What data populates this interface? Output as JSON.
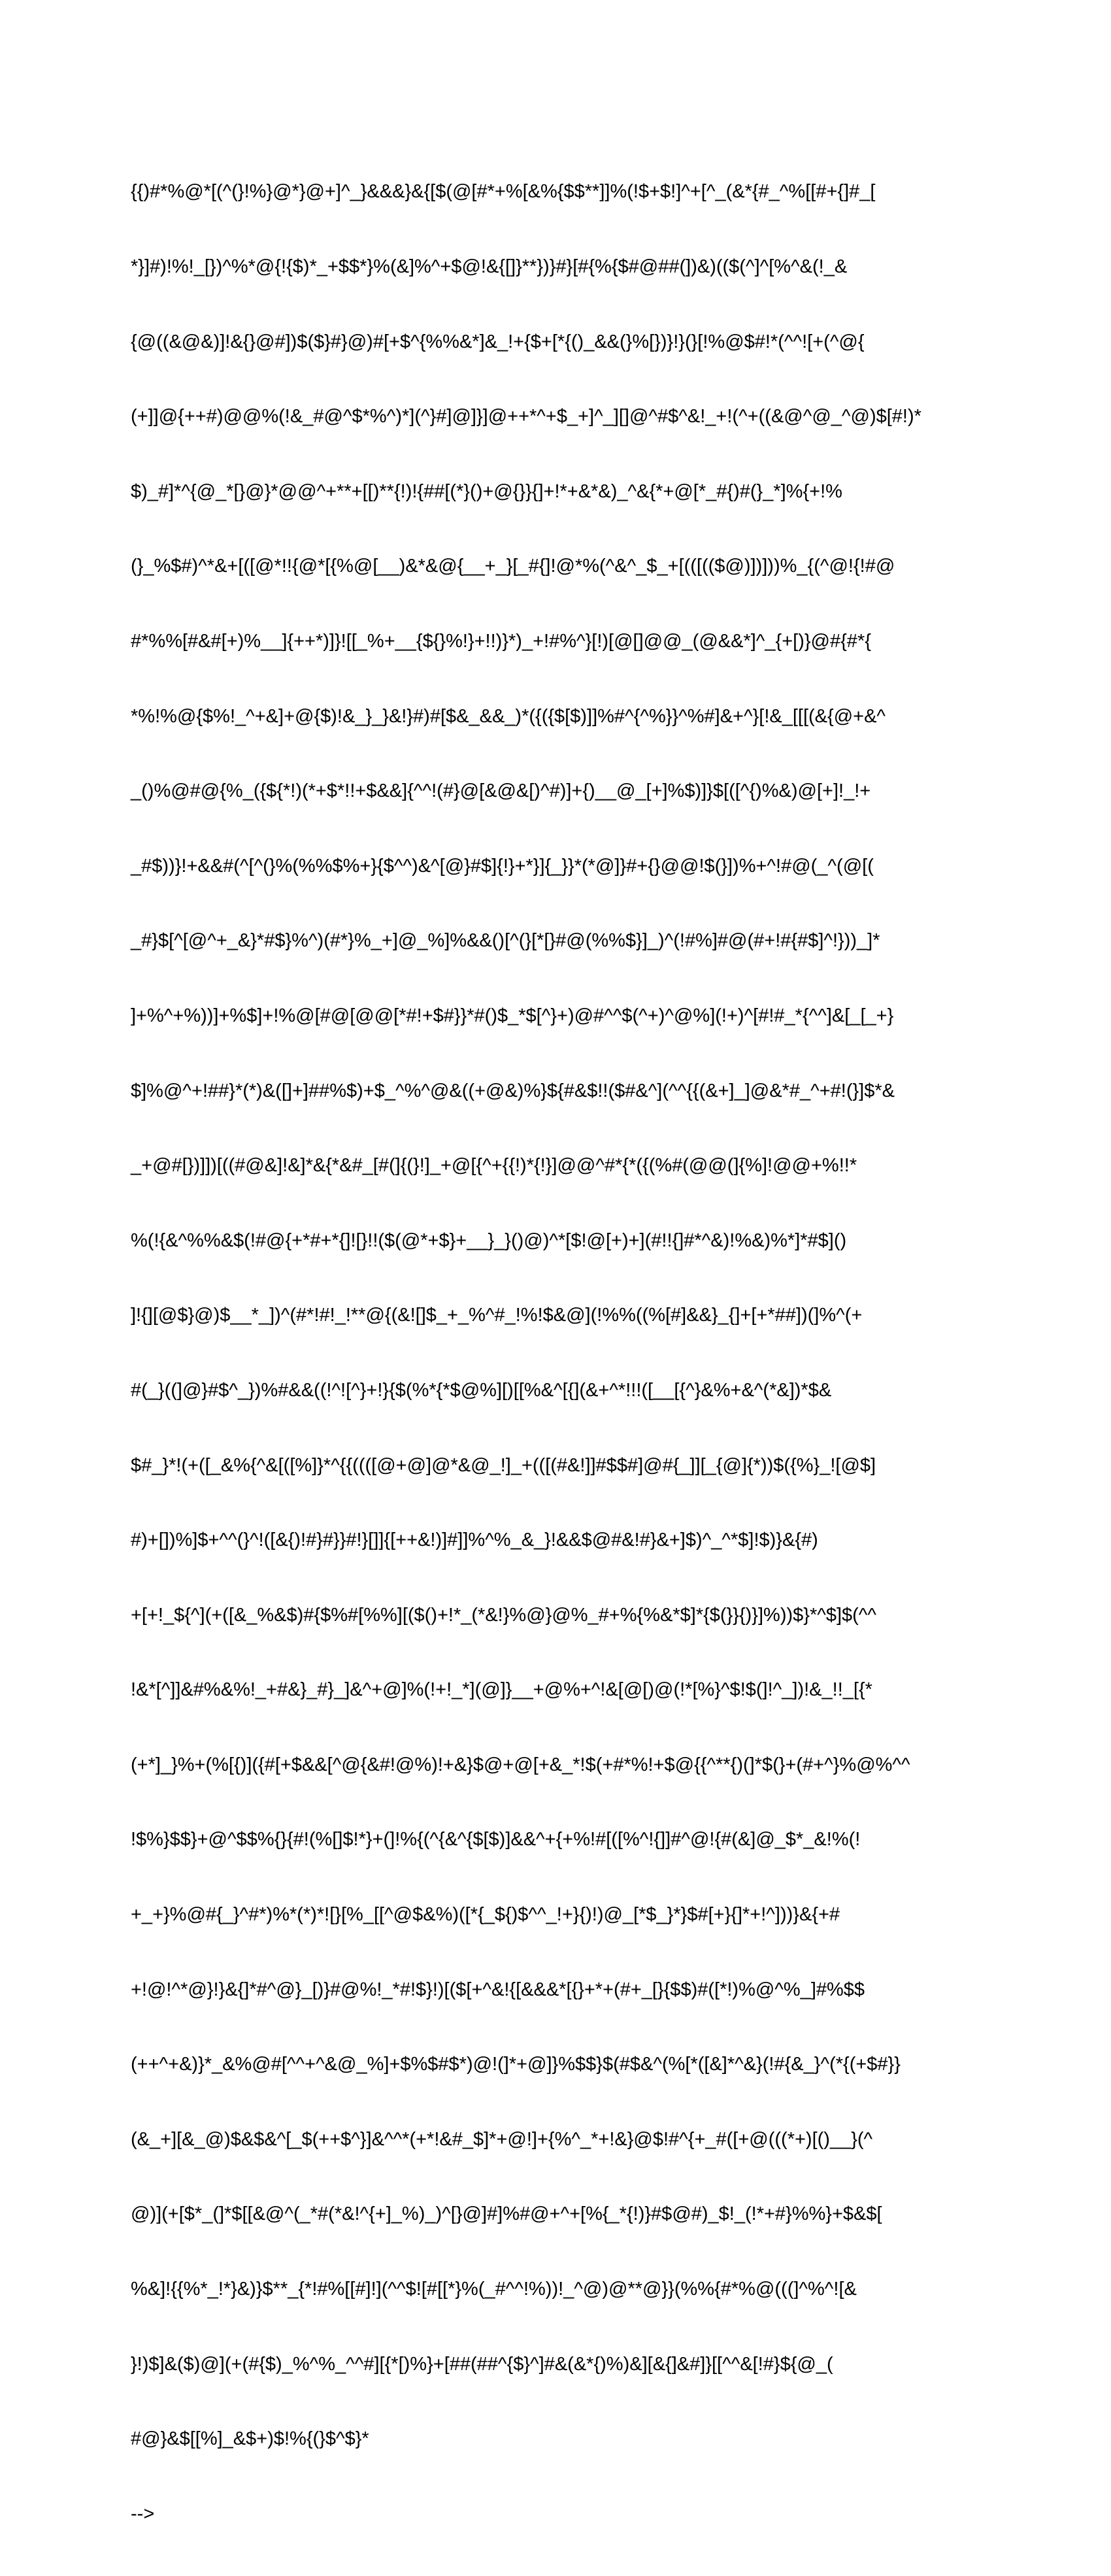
{
  "document": {
    "lines": [
      "{{)#*%@*[(^(}!%}@*}@+]^_}&&&}&{[$(@[#*+%[&%{$$**]]%(!$+$!]^+[^_(&*{#_^%[[#+{]#_[",
      "*}]#)!%!_[})^%*@{!{$)*_+$$*}%(&]%^+$@!&{[]}**})}#}[#{%{$#@##(])&)(($(^]^[%^&(!_&",
      "{@((&@&)]!&{}@#])$($}#}@)#[+$^{%%&*]&_!+{$+[*{()_&&(}%[})}!}(}[!%@$#!*(^^![+(^@{",
      "(+]]@{++#)@@%(!&_#@^$*%^)*](^}#]@]}]@++*^+$_+]^_][]@^#$^&!_+!(^+((&@^@_^@)$[#!)*",
      "$)_#]*^{@_*[}@}*@@^+**+[[)**{!)!{##[(*}()+@{}}{]+!*+&*&)_^&{*+@[*_#{)#(}_*]%{+!%",
      "(}_%$#)^*&+[([@*!!{@*[{%@[__)&*&@{__+_}[_#{]!@*%(^&^_$_+[(([(($@)])]))%_{(^@!{!#@",
      "#*%%[#&#[+)%__]{++*)]}![[_%+__{${}%!}+!!)}*)_+!#%^}[!)[@[]@@_(@&&*]^_{+[)}@#{#*{",
      "*%!%@{$%!_^+&]+@{$)!&_}_}&!}#)#[$&_&&_)*({({$[$)]]%#^{^%}}^%#]&+^}[!&_[[[(&{@+&^",
      "_()%@#@{%_({${*!)(*+$*!!+$&&]{^^!(#}@[&@&[)^#)]+{)__@_[+]%$)]}$[([^{)%&)@[+]!_!+",
      "_#$))}!+&&#(^[^(}%(%%$%+}{$^^)&^[@}#$]{!}+*}]{_}}*(*@]}#+{}@@!$(}])%+^!#@(_^(@[(",
      "_#}$[^[@^+_&}*#$}%^)(#*}%_+]@_%]%&&()[^(}[*[}#@(%%$}]_)^(!#%]#@(#+!#{#$]^!}))_]*",
      "]+%^+%))]+%$]+!%@[#@[@@[*#!+$#}}*#()$_*$[^}+)@#^^$(^+)^@%](!+)^[#!#_*{^^]&[_[_+}",
      "$]%@^+!##}*(*)&([]+]##%$)+$_^%^@&((+@&)%}${#&$!!($#&^](^^{{(&+]_]@&*#_^+#!(}]$*&",
      "_+@#[})]])[((#@&]!&]*&{*&#_[#(]{(}!]_+@[{^+{{!)*{!}]@@^#*{*({(%#(@@(]{%]!@@+%!!*",
      "%(!{&^%%&$(!#@{+*#+*{]![}!!($(@*+$}+__}_}()@)^*[$!@[+)+](#!!{]#*^&)!%&)%*]*#$]()",
      "]!{][@$}@)$__*_])^(#*!#!_!**@{(&![]$_+_%^#_!%!$&@](!%%((%[#]&&}_{]+[+*##])(]%^(+",
      "#(_}((]@}#$^_})%#&&((!^![^}+!}{$(%*{*$@%][)[[%&^[{](&+^*!!!([__[{^}&%+&^(*&])*$&",
      "$#_}*!(+([_&%{^&[([%]}*^{{((([@+@]@*&@_!]_+(([(#&!]]#$$#]@#{_]][_{@]{*))$({%}_![@$]",
      "#)+[])%]$+^^(}^!([&{)!#}#}}#!}[]]{[++&!)]#]]%^%_&_}!&&$@#&!#}&+]$)^_^*$]!$)}&{#)",
      "+[+!_${^](+([&_%&$)#{$%#[%%][($()+!*_(*&!}%@}@%_#+%{%&*$]*{$(}}{)}]%))$}*^$]$(^^",
      "!&*[^]]&#%&%!_+#&}_#}_]&^+@]%(!+!_*](@]}__+@%+^!&[@[)@(!*[%}^$!$(]!^_])!&_!!_[{*",
      "(+*]_}%+(%[{)]({#[+$&&[^@{&#!@%)!+&}$@+@[+&_*!$(+#*%!+$@{{^**{)(]*$(}+(#+^}%@%^^",
      "!$%}$$}+@^$$%{}{#!(%[]$!*}+(]!%{(^{&^{$[$)]&&^+{+%!#[([%^!{]]#^@!{#(&]@_$*_&!%(!",
      "+_+}%@#{_}^#*)%*(*)*![}[%_[[^@$&%)([*{_${)$^^_!+}{)!)@_[*$_}*}$#[+}{]*+!^]))}&{+#",
      "+!@!^*@}!}&{]*#^@}_[)}#@%!_*#!$}!)[($[+^&!{[&&&*[{}+*+(#+_[}{$$)#([*!)%@^%_]#%$$",
      "(++^+&)}*_&%@#[^^+^&@_%]+$%$#$*)@!(]*+@]}%$$}$(#$&^(%[*([&]*^&}(!#{&_}^(*{(+$#}}",
      "(&_+][&_@)$&$&^[_$(++$^}]&^^*(+*!&#_$]*+@!]+{%^_*+!&}@$!#^{+_#([+@(((*+)[()__}(^",
      "@)](+[$*_(]*$[[&@^(_*#(*&!^{+]_%)_)^[}@]#]%#@+^+[%{_*{!)}#$@#)_$!_(!*+#}%%}+$&$[",
      "%&]!{{%*_!*}&)}$**_{*!#%[[#]!](^^$![#[[*}%(_#^^!%))!_^@)@**@}}(%%{#*%@(((]^%^![&",
      "}!)$]&($)@](+(#{$)_%^%_^^#][{*[)%}+[##(##^{$}^]#&(&*{)%)&][&{]&#]}[[^^&[!#}${@_(",
      "#@}&$[[%]_&$+)$!%{(}$^$}*",
      "-->"
    ]
  }
}
